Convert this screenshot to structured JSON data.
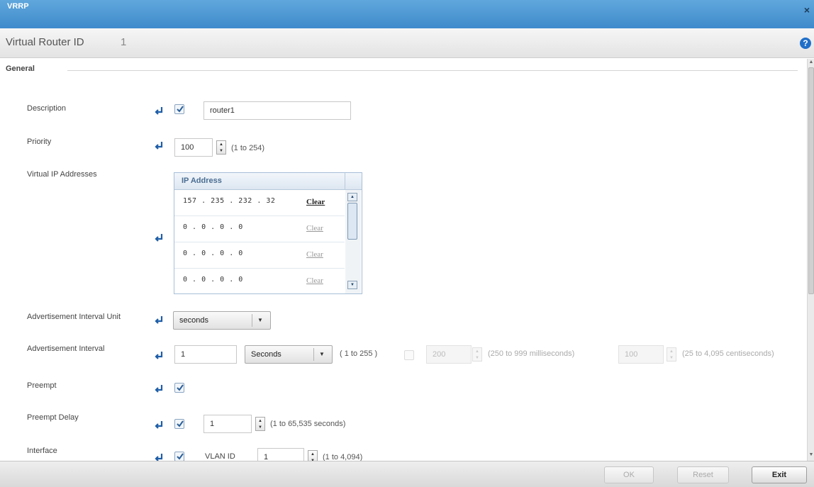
{
  "window": {
    "title": "VRRP",
    "close_glyph": "×"
  },
  "header": {
    "label": "Virtual Router ID",
    "value": "1",
    "help_glyph": "?"
  },
  "section": {
    "legend": "General"
  },
  "fields": {
    "description": {
      "label": "Description",
      "value": "router1",
      "enabled": true
    },
    "priority": {
      "label": "Priority",
      "value": "100",
      "hint": "(1 to 254)"
    },
    "virtual_ip": {
      "label": "Virtual IP Addresses",
      "column_header": "IP Address",
      "rows": [
        {
          "ip": "157 . 235 . 232 . 32",
          "clear": "Clear",
          "active": true
        },
        {
          "ip": "0 . 0 . 0 . 0",
          "clear": "Clear",
          "active": false
        },
        {
          "ip": "0 . 0 . 0 . 0",
          "clear": "Clear",
          "active": false
        },
        {
          "ip": "0 . 0 . 0 . 0",
          "clear": "Clear",
          "active": false
        }
      ]
    },
    "adv_interval_unit": {
      "label": "Advertisement Interval Unit",
      "value": "seconds"
    },
    "adv_interval": {
      "label": "Advertisement Interval",
      "value": "1",
      "unit": "Seconds",
      "hint": "( 1 to 255 )",
      "ms_value": "200",
      "ms_hint": "(250 to 999 milliseconds)",
      "cs_value": "100",
      "cs_hint": "(25 to 4,095 centiseconds)"
    },
    "preempt": {
      "label": "Preempt",
      "checked": true
    },
    "preempt_delay": {
      "label": "Preempt Delay",
      "value": "1",
      "hint": "(1 to 65,535 seconds)",
      "checked": true
    },
    "interface": {
      "label": "Interface",
      "sub_label": "VLAN ID",
      "value": "1",
      "hint": "(1 to 4,094)",
      "checked": true
    }
  },
  "footer": {
    "ok": "OK",
    "reset": "Reset",
    "exit": "Exit"
  },
  "colors": {
    "title_bar": "#4f9bd6",
    "accent": "#1f6fc9",
    "link_active": "#222222"
  },
  "icons": {
    "override": "override-arrow-icon",
    "check": "check-icon",
    "help": "help-icon",
    "close": "close-icon"
  }
}
